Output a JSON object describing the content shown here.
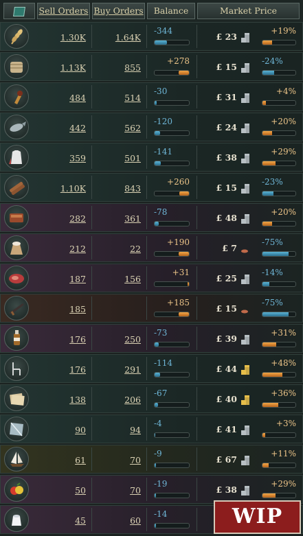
{
  "header": {
    "sell_label": "Sell Orders",
    "buy_label": "Buy Orders",
    "balance_label": "Balance",
    "price_label": "Market Price"
  },
  "currency_symbol": "£",
  "colors": {
    "positive": "#ecc488",
    "negative": "#6fb7d8",
    "wip_bg": "#8c1d1d"
  },
  "rows": [
    {
      "icon": "wheat-icon",
      "tint": "green",
      "sell": "1.30K",
      "buy": "1.64K",
      "balance": "-344",
      "balance_fill": 0.35,
      "price": "23",
      "coin": "silver-coins-icon",
      "change": "+19%",
      "change_fill": 0.3
    },
    {
      "icon": "fabric-icon",
      "tint": "green",
      "sell": "1.13K",
      "buy": "855",
      "balance": "+278",
      "balance_fill": 0.3,
      "price": "15",
      "coin": "silver-coins-icon",
      "change": "-24%",
      "change_fill": 0.35
    },
    {
      "icon": "torch-icon",
      "tint": "green",
      "sell": "484",
      "buy": "514",
      "balance": "-30",
      "balance_fill": 0.05,
      "price": "31",
      "coin": "silver-coins-icon",
      "change": "+4%",
      "change_fill": 0.1
    },
    {
      "icon": "fish-icon",
      "tint": "green",
      "sell": "442",
      "buy": "562",
      "balance": "-120",
      "balance_fill": 0.15,
      "price": "24",
      "coin": "silver-coins-icon",
      "change": "+20%",
      "change_fill": 0.3
    },
    {
      "icon": "clothes-icon",
      "tint": "green",
      "sell": "359",
      "buy": "501",
      "balance": "-141",
      "balance_fill": 0.18,
      "price": "38",
      "coin": "silver-coins-icon",
      "change": "+29%",
      "change_fill": 0.4
    },
    {
      "icon": "wood-icon",
      "tint": "green",
      "sell": "1.10K",
      "buy": "843",
      "balance": "+260",
      "balance_fill": 0.28,
      "price": "15",
      "coin": "silver-coins-icon",
      "change": "-23%",
      "change_fill": 0.33
    },
    {
      "icon": "furniture-icon",
      "tint": "purple",
      "sell": "282",
      "buy": "361",
      "balance": "-78",
      "balance_fill": 0.12,
      "price": "48",
      "coin": "silver-coins-icon",
      "change": "+20%",
      "change_fill": 0.3
    },
    {
      "icon": "grain-sack-icon",
      "tint": "purple",
      "sell": "212",
      "buy": "22",
      "balance": "+190",
      "balance_fill": 0.3,
      "price": "7",
      "coin": "copper-coin-icon",
      "change": "-75%",
      "change_fill": 0.8
    },
    {
      "icon": "meat-icon",
      "tint": "purple",
      "sell": "187",
      "buy": "156",
      "balance": "+31",
      "balance_fill": 0.05,
      "price": "25",
      "coin": "silver-coins-icon",
      "change": "-14%",
      "change_fill": 0.2
    },
    {
      "icon": "small-arms-icon",
      "tint": "brown",
      "sell": "185",
      "buy": "",
      "balance": "+185",
      "balance_fill": 0.3,
      "price": "15",
      "coin": "copper-coin-icon",
      "change": "-75%",
      "change_fill": 0.8
    },
    {
      "icon": "liquor-icon",
      "tint": "purple",
      "sell": "176",
      "buy": "250",
      "balance": "-73",
      "balance_fill": 0.12,
      "price": "39",
      "coin": "silver-coins-icon",
      "change": "+31%",
      "change_fill": 0.42
    },
    {
      "icon": "chair-icon",
      "tint": "green",
      "sell": "176",
      "buy": "291",
      "balance": "-114",
      "balance_fill": 0.15,
      "price": "44",
      "coin": "gold-coins-icon",
      "change": "+48%",
      "change_fill": 0.6
    },
    {
      "icon": "paper-icon",
      "tint": "green",
      "sell": "138",
      "buy": "206",
      "balance": "-67",
      "balance_fill": 0.1,
      "price": "40",
      "coin": "gold-coins-icon",
      "change": "+36%",
      "change_fill": 0.48
    },
    {
      "icon": "glass-icon",
      "tint": "green",
      "sell": "90",
      "buy": "94",
      "balance": "-4",
      "balance_fill": 0.02,
      "price": "41",
      "coin": "silver-coins-icon",
      "change": "+3%",
      "change_fill": 0.08
    },
    {
      "icon": "clipper-ship-icon",
      "tint": "olive",
      "sell": "61",
      "buy": "70",
      "balance": "-9",
      "balance_fill": 0.03,
      "price": "67",
      "coin": "silver-coins-icon",
      "change": "+11%",
      "change_fill": 0.18
    },
    {
      "icon": "fruit-icon",
      "tint": "purple",
      "sell": "50",
      "buy": "70",
      "balance": "-19",
      "balance_fill": 0.04,
      "price": "38",
      "coin": "silver-coins-icon",
      "change": "+29%",
      "change_fill": 0.4
    },
    {
      "icon": "porcelain-icon",
      "tint": "purple",
      "sell": "45",
      "buy": "60",
      "balance": "-14",
      "balance_fill": 0.03,
      "price": "",
      "coin": "",
      "change": "",
      "change_fill": 0
    }
  ],
  "overlay": {
    "wip_label": "WIP"
  }
}
